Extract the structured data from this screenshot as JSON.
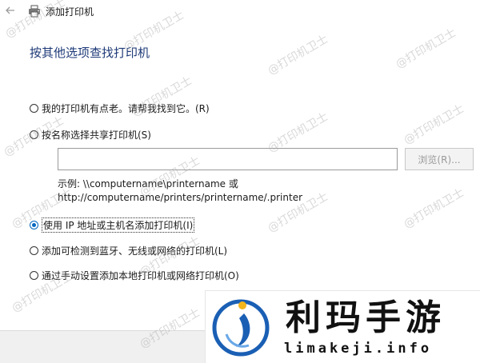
{
  "window": {
    "title": "添加打印机"
  },
  "heading": "按其他选项查找打印机",
  "options": [
    {
      "label": "我的打印机有点老。请帮我找到它。(R)",
      "selected": false
    },
    {
      "label": "按名称选择共享打印机(S)",
      "selected": false
    },
    {
      "label": "使用 IP 地址或主机名添加打印机(I)",
      "selected": true
    },
    {
      "label": "添加可检测到蓝牙、无线或网络的打印机(L)",
      "selected": false
    },
    {
      "label": "通过手动设置添加本地打印机或网络打印机(O)",
      "selected": false
    }
  ],
  "share_input": {
    "value": ""
  },
  "browse_label": "浏览(R)...",
  "example": {
    "line1": "示例: \\\\computername\\printername 或",
    "line2": "http://computername/printers/printername/.printer"
  },
  "watermark_text": "@打印机卫士",
  "logo": {
    "cn": "利玛手游",
    "en": "limakeji.info"
  },
  "colors": {
    "heading": "#1e3a78",
    "radio_selected": "#0067c0",
    "logo_blue": "#1a5fb4"
  }
}
